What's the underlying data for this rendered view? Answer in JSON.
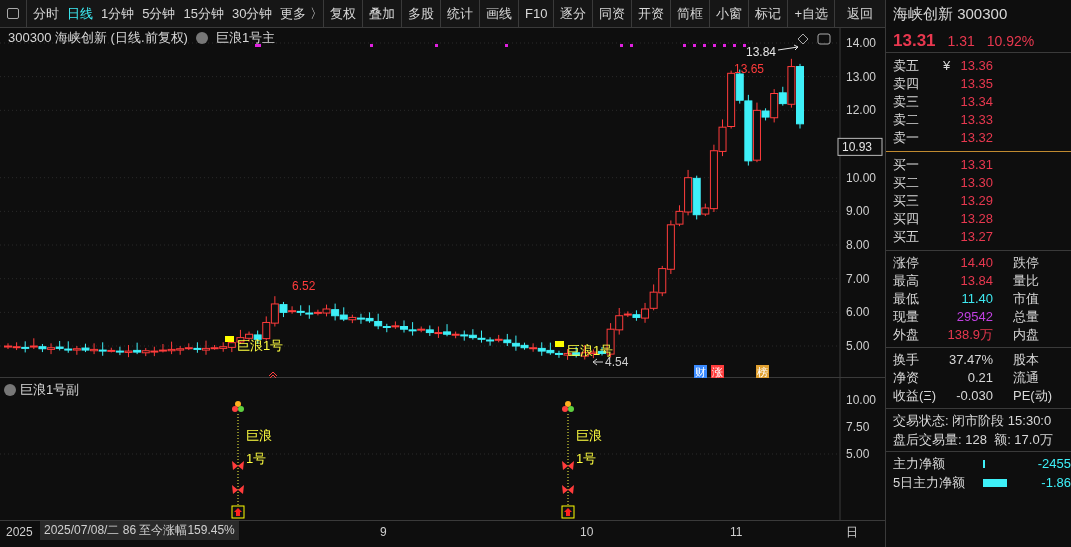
{
  "toolbar": {
    "periods": [
      {
        "label": "分时",
        "selected": false
      },
      {
        "label": "日线",
        "selected": true
      },
      {
        "label": "1分钟",
        "selected": false
      },
      {
        "label": "5分钟",
        "selected": false
      },
      {
        "label": "15分钟",
        "selected": false
      },
      {
        "label": "30分钟",
        "selected": false
      },
      {
        "label": "更多 〉",
        "selected": false
      }
    ],
    "buttons": [
      "复权",
      "叠加",
      "多股",
      "统计",
      "画线",
      "F10",
      "逐分",
      "同资",
      "开资",
      "简框",
      "小窗",
      "标记",
      "+自选",
      "返回"
    ]
  },
  "chart": {
    "title": "300300 海峡创新 (日线.前复权)",
    "indicator": "巨浪1号主",
    "yticks": [
      "14.00",
      "13.00",
      "12.00",
      "10.00",
      "9.00",
      "8.00",
      "7.00",
      "6.00",
      "5.00"
    ],
    "price_tag": "10.93",
    "annotations": [
      {
        "kind": "high",
        "text": "6.52"
      },
      {
        "kind": "high",
        "text": "13.65"
      },
      {
        "kind": "peak",
        "text": "13.84"
      },
      {
        "kind": "low",
        "text": "4.54"
      }
    ],
    "signals": [
      "巨浪1号",
      "巨浪1号"
    ],
    "badges": [
      {
        "text": "财",
        "color": "#3b8bff"
      },
      {
        "text": "涨",
        "color": "#ff3c3c"
      },
      {
        "text": "榜",
        "color": "#e0a030"
      }
    ]
  },
  "sub_chart": {
    "title": "巨浪1号副",
    "yticks": [
      "10.00",
      "7.50",
      "5.00"
    ],
    "signals": [
      {
        "line1": "巨浪",
        "line2": "1号"
      },
      {
        "line1": "巨浪",
        "line2": "1号"
      }
    ]
  },
  "x_axis": {
    "start": "2025",
    "tooltip": "2025/07/08/二 86 至今涨幅159.45%",
    "labels": [
      "9",
      "10",
      "11"
    ],
    "end": "日"
  },
  "quote": {
    "name": "海峡创新 300300",
    "price": "13.31",
    "change": "1.31",
    "pct": "10.92%",
    "asks": [
      {
        "label": "卖五",
        "suffix": "¥",
        "price": "13.36"
      },
      {
        "label": "卖四",
        "price": "13.35"
      },
      {
        "label": "卖三",
        "price": "13.34"
      },
      {
        "label": "卖二",
        "price": "13.33"
      },
      {
        "label": "卖一",
        "price": "13.32"
      }
    ],
    "bids": [
      {
        "label": "买一",
        "price": "13.31"
      },
      {
        "label": "买二",
        "price": "13.30"
      },
      {
        "label": "买三",
        "price": "13.29"
      },
      {
        "label": "买四",
        "price": "13.28"
      },
      {
        "label": "买五",
        "price": "13.27"
      }
    ],
    "stats": [
      {
        "label": "涨停",
        "value": "14.40",
        "color": "#e8384f",
        "label2": "跌停"
      },
      {
        "label": "最高",
        "value": "13.84",
        "color": "#e8384f",
        "label2": "量比"
      },
      {
        "label": "最低",
        "value": "11.40",
        "color": "#3ee8f0",
        "label2": "市值"
      },
      {
        "label": "现量",
        "value": "29542",
        "color": "#c040e0",
        "label2": "总量"
      },
      {
        "label": "外盘",
        "value": "138.9万",
        "color": "#e8384f",
        "label2": "内盘"
      }
    ],
    "fundamentals": [
      {
        "label": "换手",
        "value": "37.47%",
        "label2": "股本"
      },
      {
        "label": "净资",
        "value": "0.21",
        "label2": "流通"
      },
      {
        "label": "收益(Ξ)",
        "value": "-0.030",
        "label2": "PE(动)"
      }
    ],
    "status": [
      "交易状态: 闭市阶段 15:30:0",
      "盘后交易量: 128  额: 17.0万"
    ],
    "flows": [
      {
        "label": "主力净额",
        "value": "-2455"
      },
      {
        "label": "5日主力净额",
        "value": "-1.86"
      }
    ]
  }
}
